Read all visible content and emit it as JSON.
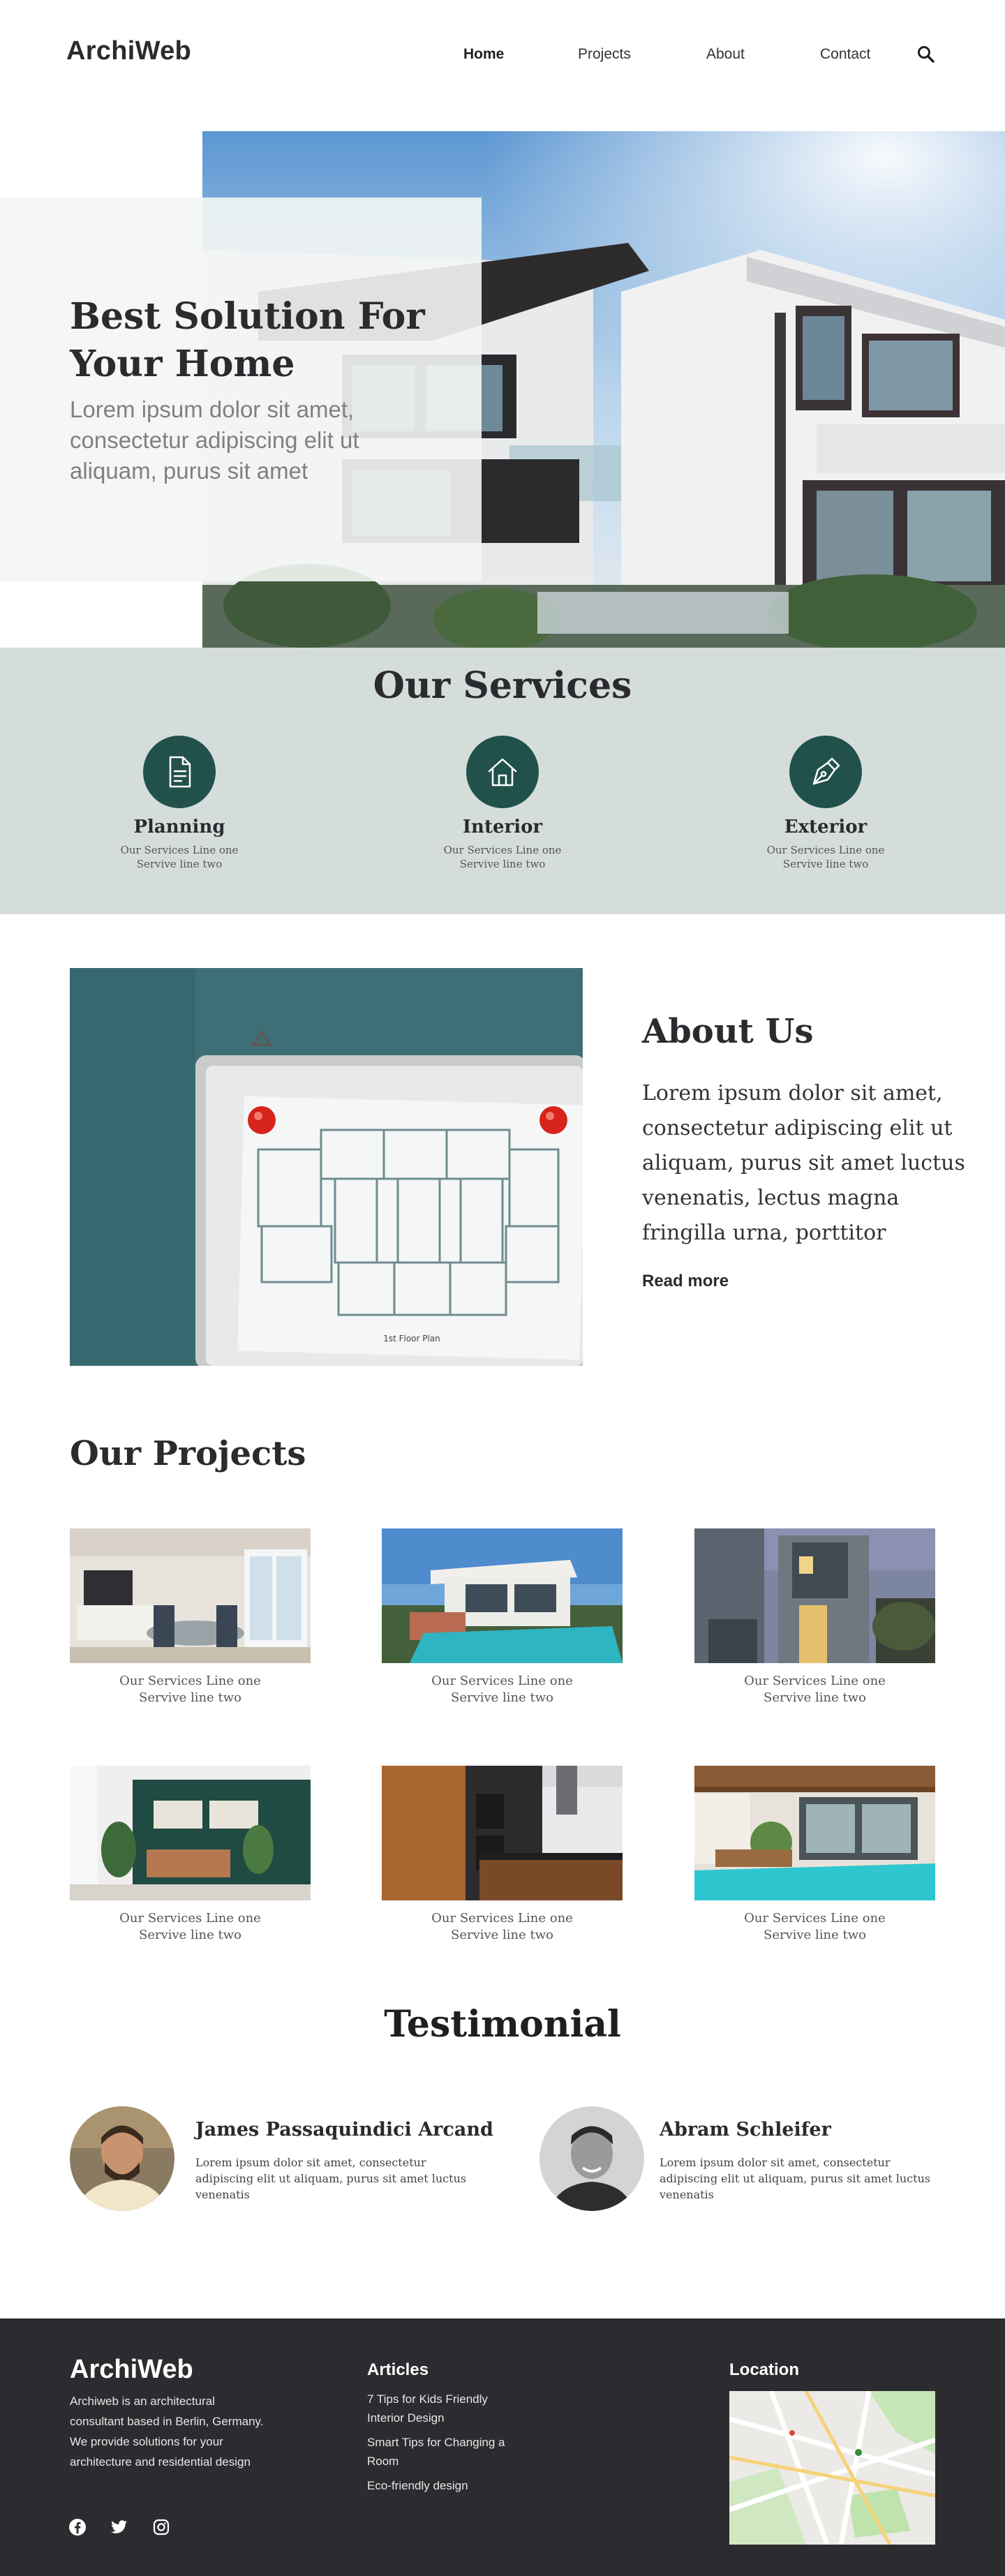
{
  "header": {
    "logo": "ArchiWeb",
    "nav": [
      "Home",
      "Projects",
      "About",
      "Contact"
    ],
    "search_icon": "search-icon"
  },
  "hero": {
    "title": "Best Solution For Your Home",
    "subtitle": "Lorem ipsum dolor sit amet, consectetur adipiscing elit ut aliquam, purus sit amet"
  },
  "services": {
    "title": "Our Services",
    "items": [
      {
        "name": "Planning",
        "line1": "Our Services Line one",
        "line2": "Servive line two",
        "icon": "document-icon"
      },
      {
        "name": "Interior",
        "line1": "Our Services Line one",
        "line2": "Servive line two",
        "icon": "house-icon"
      },
      {
        "name": "Exterior",
        "line1": "Our Services Line one",
        "line2": "Servive line two",
        "icon": "pen-nib-icon"
      }
    ]
  },
  "about": {
    "title": "About Us",
    "text": "Lorem ipsum dolor sit amet, consectetur adipiscing elit ut aliquam, purus sit amet luctus venenatis, lectus magna fringilla urna, porttitor",
    "read_more": "Read more",
    "plan_caption": "1st Floor Plan"
  },
  "projects": {
    "title": "Our Projects",
    "items": [
      {
        "line1": "Our Services Line one",
        "line2": "Servive line two"
      },
      {
        "line1": "Our Services Line one",
        "line2": "Servive line two"
      },
      {
        "line1": "Our Services Line one",
        "line2": "Servive line two"
      },
      {
        "line1": "Our Services Line one",
        "line2": "Servive line two"
      },
      {
        "line1": "Our Services Line one",
        "line2": "Servive line two"
      },
      {
        "line1": "Our Services Line one",
        "line2": "Servive line two"
      }
    ]
  },
  "testimonial": {
    "title": "Testimonial",
    "items": [
      {
        "name": "James Passaquindici Arcand",
        "text": "Lorem ipsum dolor sit amet, consectetur adipiscing elit ut aliquam, purus sit amet luctus venenatis"
      },
      {
        "name": "Abram Schleifer",
        "text": "Lorem ipsum dolor sit amet, consectetur adipiscing elit ut aliquam, purus sit amet luctus venenatis"
      }
    ]
  },
  "footer": {
    "logo": "ArchiWeb",
    "about": "Archiweb is an architectural consultant based in Berlin, Germany. We provide solutions for your architecture and residential design",
    "articles_title": "Articles",
    "articles": [
      "7 Tips for Kids Friendly Interior Design",
      "Smart Tips for Changing a Room",
      "Eco-friendly design"
    ],
    "location_title": "Location",
    "social_icons": [
      "facebook-icon",
      "twitter-icon",
      "instagram-icon"
    ]
  },
  "colors": {
    "accent": "#22514b",
    "services_bg": "#d5dddb",
    "footer_bg": "#2c2c30",
    "text": "#2b2b2f"
  }
}
